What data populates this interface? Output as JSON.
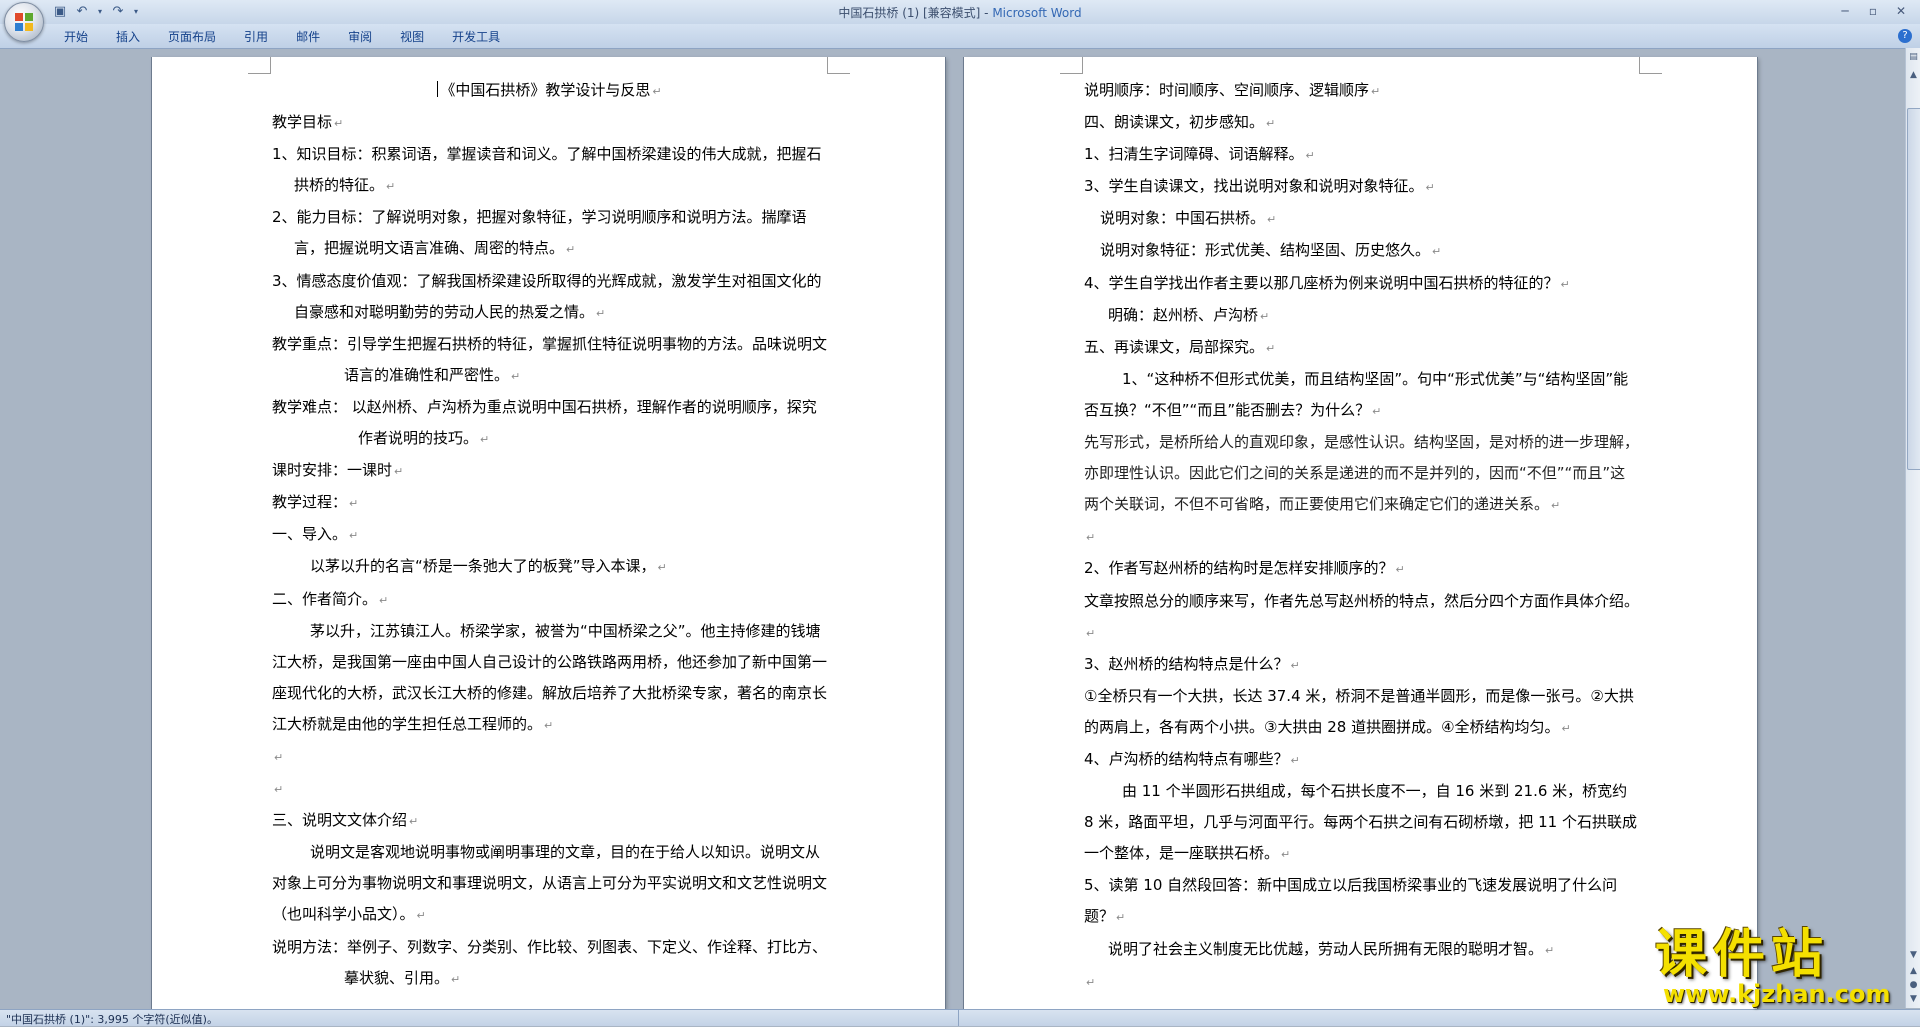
{
  "window": {
    "title_doc": "中国石拱桥 (1) [兼容模式] - ",
    "title_app": "Microsoft Word"
  },
  "ribbon": {
    "tabs": [
      "开始",
      "插入",
      "页面布局",
      "引用",
      "邮件",
      "审阅",
      "视图",
      "开发工具"
    ]
  },
  "status": {
    "text": "\"中国石拱桥 (1)\": 3,995 个字符(近似值)。"
  },
  "watermark": {
    "brand": "课件站",
    "url": "www.kjzhan.com"
  },
  "document": {
    "left_page": [
      "《中国石拱桥》教学设计与反思",
      "教学目标",
      "1、知识目标：积累词语，掌握读音和词义。了解中国桥梁建设的伟大成就，把握石拱桥的特征。",
      "2、能力目标：了解说明对象，把握对象特征，学习说明顺序和说明方法。揣摩语言，把握说明文语言准确、周密的特点。",
      "3、情感态度价值观：了解我国桥梁建设所取得的光辉成就，激发学生对祖国文化的自豪感和对聪明勤劳的劳动人民的热爱之情。",
      "教学重点：引导学生把握石拱桥的特征，掌握抓住特征说明事物的方法。品味说明文语言的准确性和严密性。",
      "教学难点：   以赵州桥、卢沟桥为重点说明中国石拱桥，理解作者的说明顺序，探究作者说明的技巧。",
      "课时安排：一课时",
      "教学过程：",
      "一、导入。",
      "以茅以升的名言“桥是一条弛大了的板凳”导入本课，",
      "二、作者简介。",
      "茅以升，江苏镇江人。桥梁学家，被誉为“中国桥梁之父”。他主持修建的钱塘江大桥，是我国第一座由中国人自己设计的公路铁路两用桥，他还参加了新中国第一座现代化的大桥，武汉长江大桥的修建。解放后培养了大批桥梁专家，著名的南京长江大桥就是由他的学生担任总工程师的。",
      "",
      "",
      "三、说明文文体介绍",
      "说明文是客观地说明事物或阐明事理的文章，目的在于给人以知识。说明文从对象上可分为事物说明文和事理说明文，从语言上可分为平实说明文和文艺性说明文（也叫科学小品文）。",
      "说明方法：举例子、列数字、分类别、作比较、列图表、下定义、作诠释、打比方、摹状貌、引用。"
    ],
    "right_page": [
      "说明顺序：时间顺序、空间顺序、逻辑顺序",
      "四、朗读课文，初步感知。",
      "1、扫清生字词障碍、词语解释。",
      "3、学生自读课文，找出说明对象和说明对象特征。",
      "说明对象：中国石拱桥。",
      "说明对象特征：形式优美、结构坚固、历史悠久。",
      "4、学生自学找出作者主要以那几座桥为例来说明中国石拱桥的特征的？",
      "明确：赵州桥、卢沟桥",
      "五、再读课文，局部探究。",
      "1、“这种桥不但形式优美，而且结构坚固”。句中“形式优美”与“结构坚固”能否互换？“不但”“而且”能否删去？为什么？",
      "先写形式，是桥所给人的直观印象，是感性认识。结构坚固，是对桥的进一步理解，亦即理性认识。因此它们之间的关系是递进的而不是并列的，因而“不但”“而且”这两个关联词，不但不可省略，而正要使用它们来确定它们的递进关系。",
      "",
      "2、作者写赵州桥的结构时是怎样安排顺序的？",
      "文章按照总分的顺序来写，作者先总写赵州桥的特点，然后分四个方面作具体介绍。",
      "3、赵州桥的结构特点是什么？",
      "①全桥只有一个大拱，长达 37.4 米，桥洞不是普通半圆形，而是像一张弓。②大拱的两肩上，各有两个小拱。③大拱由 28 道拱圈拼成。④全桥结构均匀。",
      "4、卢沟桥的结构特点有哪些？",
      "由 11 个半圆形石拱组成，每个石拱长度不一，自 16 米到 21.6 米，桥宽约 8 米，路面平坦，几乎与河面平行。每两个石拱之间有石砌桥墩，把 11 个石拱联成一个整体，是一座联拱石桥。",
      "5、读第 10 自然段回答：新中国成立以后我国桥梁事业的飞速发展说明了什么问题？",
      "说明了社会主义制度无比优越，劳动人民所拥有无限的聪明才智。",
      ""
    ]
  }
}
